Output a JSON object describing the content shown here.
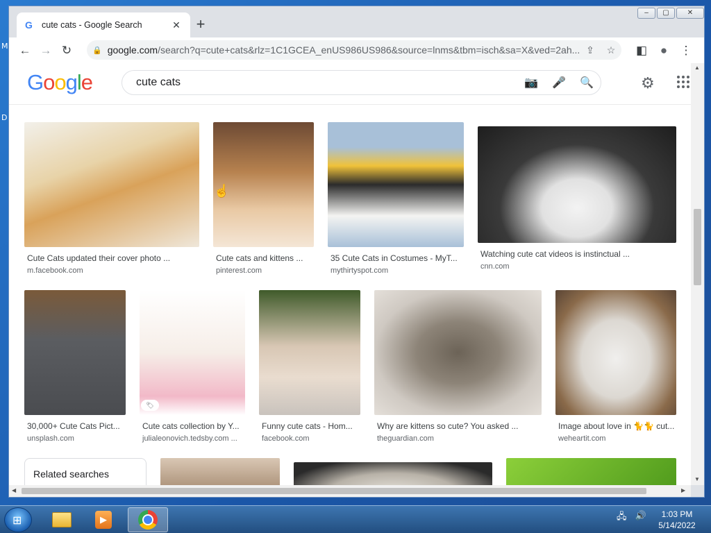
{
  "desktop": {
    "left_letters": [
      "M",
      "D"
    ]
  },
  "window": {
    "tab_title": "cute cats - Google Search",
    "tab_close": "✕",
    "new_tab": "+",
    "controls": {
      "minimize": "‒",
      "maximize": "▢",
      "close": "✕"
    }
  },
  "toolbar": {
    "back": "←",
    "forward": "→",
    "reload": "↻",
    "url_host": "google.com",
    "url_path": "/search?q=cute+cats&rlz=1C1GCEA_enUS986US986&source=lnms&tbm=isch&sa=X&ved=2ah...",
    "share_icon": "⇪",
    "star_icon": "☆",
    "sidepanel_icon": "◧",
    "profile_icon": "●",
    "menu_icon": "⋮"
  },
  "google": {
    "logo_letters": [
      "G",
      "o",
      "o",
      "g",
      "l",
      "e"
    ],
    "query": "cute cats",
    "camera_icon": "📷",
    "mic_icon": "🎤",
    "search_icon": "🔍",
    "settings_icon": "⚙"
  },
  "results": [
    {
      "title": "Cute Cats updated their cover photo ...",
      "source": "m.facebook.com"
    },
    {
      "title": "Cute cats and kittens ...",
      "source": "pinterest.com"
    },
    {
      "title": "35 Cute Cats in Costumes - MyT...",
      "source": "mythirtyspot.com"
    },
    {
      "title": "Watching cute cat videos is instinctual ...",
      "source": "cnn.com"
    },
    {
      "title": "30,000+ Cute Cats Pict...",
      "source": "unsplash.com"
    },
    {
      "title": "Cute cats collection by Y...",
      "source": "julialeonovich.tedsby.com ..."
    },
    {
      "title": "Funny cute cats - Hom...",
      "source": "facebook.com"
    },
    {
      "title": "Why are kittens so cute? You asked ...",
      "source": "theguardian.com"
    },
    {
      "title": "Image about love in 🐈🐈 cut...",
      "source": "weheartit.com"
    }
  ],
  "related_searches": "Related searches",
  "tag_icon": "🏷",
  "taskbar": {
    "time": "1:03 PM",
    "date": "5/14/2022",
    "media_icon": "▶"
  }
}
